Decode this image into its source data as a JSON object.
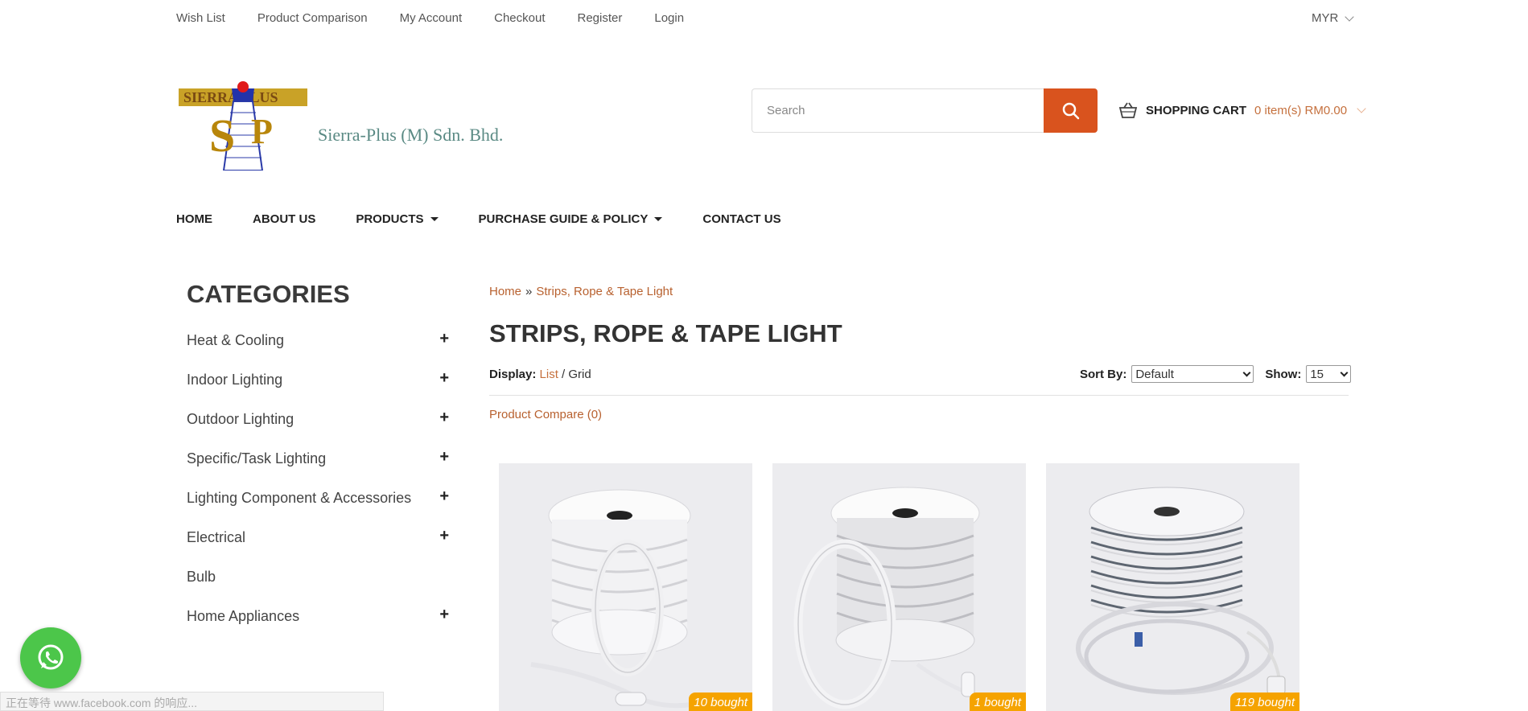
{
  "toplinks": [
    "Wish List",
    "Product Comparison",
    "My Account",
    "Checkout",
    "Register",
    "Login"
  ],
  "currency": "MYR",
  "logo": {
    "company_name": "Sierra-Plus (M) Sdn. Bhd.",
    "emblem_text": "SIERRA PLUS SP"
  },
  "search": {
    "placeholder": "Search"
  },
  "cart": {
    "label": "SHOPPING CART",
    "value": "0 item(s) RM0.00"
  },
  "mainnav": {
    "home": "HOME",
    "about": "ABOUT US",
    "products": "PRODUCTS",
    "purchase": "PURCHASE GUIDE & POLICY",
    "contact": "CONTACT US"
  },
  "sidebar": {
    "title": "CATEGORIES",
    "items": [
      {
        "label": "Heat & Cooling",
        "expand": "+"
      },
      {
        "label": "Indoor Lighting",
        "expand": "+"
      },
      {
        "label": "Outdoor Lighting",
        "expand": "+"
      },
      {
        "label": "Specific/Task Lighting",
        "expand": "+"
      },
      {
        "label": "Lighting Component & Accessories",
        "expand": "+"
      },
      {
        "label": "Electrical",
        "expand": "+"
      },
      {
        "label": "Bulb",
        "expand": ""
      },
      {
        "label": "Home Appliances",
        "expand": "+"
      }
    ]
  },
  "breadcrumb": {
    "home": "Home",
    "sep": "»",
    "current": "Strips, Rope & Tape Light"
  },
  "page_title": "STRIPS, ROPE & TAPE LIGHT",
  "display": {
    "label": "Display:",
    "list": "List",
    "slash": "/",
    "grid": "Grid"
  },
  "sort": {
    "label": "Sort By:",
    "value": "Default",
    "show_label": "Show:",
    "show_value": "15"
  },
  "compare": "Product Compare (0)",
  "products": [
    {
      "badge": "10 bought"
    },
    {
      "badge": "1 bought"
    },
    {
      "badge": "119 bought"
    }
  ],
  "status_bar": "正在等待 www.facebook.com 的响应...",
  "colors": {
    "accent": "#d9531e",
    "link": "#b8612f",
    "badge": "#f5a300",
    "whatsapp": "#4cc64a"
  }
}
